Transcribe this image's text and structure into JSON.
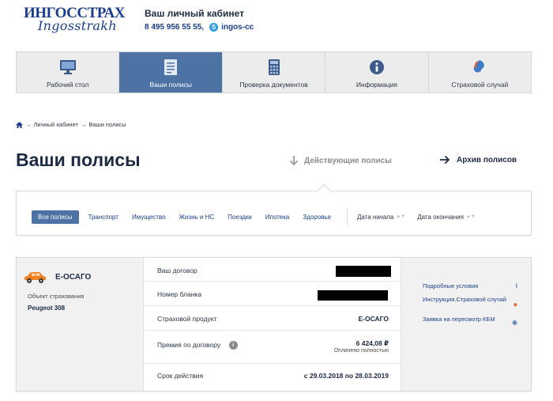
{
  "header": {
    "logo_main": "ИНГОССТРАХ",
    "logo_sub": "Ingosstrakh",
    "cabinet_title": "Ваш личный кабинет",
    "phone": "8 495 956 55 55,",
    "skype": "ingos-cc"
  },
  "nav": {
    "items": [
      {
        "label": "Рабочий стол",
        "icon": "desktop-icon"
      },
      {
        "label": "Ваши полисы",
        "icon": "document-icon"
      },
      {
        "label": "Проверка документов",
        "icon": "calculator-icon"
      },
      {
        "label": "Информация",
        "icon": "info-icon"
      },
      {
        "label": "Страховой случай",
        "icon": "swirl-icon"
      }
    ],
    "active_index": 1
  },
  "breadcrumb": {
    "items": [
      "Личный кабинет",
      "Ваши полисы"
    ],
    "separator": "→"
  },
  "page": {
    "title": "Ваши полисы",
    "tab_active": "Действующие полисы",
    "tab_archive": "Архив полисов"
  },
  "filters": {
    "chips": [
      "Все полисы",
      "Транспорт",
      "Имущество",
      "Жизнь и НС",
      "Поездки",
      "Ипотека",
      "Здоровье"
    ],
    "sort": [
      "Дата начала",
      "Дата окончания"
    ]
  },
  "policy": {
    "name": "Е-ОСАГО",
    "object_label": "Объект страхования",
    "object_value": "Peugeot 308",
    "rows": {
      "contract_label": "Ваш договор",
      "blank_label": "Номер бланка",
      "product_label": "Страховой продукт",
      "product_value": "Е-ОСАГО",
      "premium_label": "Премия по договору",
      "premium_value": "6 424,08 ₽",
      "premium_status": "Оплачено полностью",
      "period_label": "Срок действия",
      "period_value": "с 29.03.2018 по 28.03.2019"
    },
    "links": [
      {
        "label": "Подробные условия",
        "icon": "info-small-icon"
      },
      {
        "label": "Инструкция.Страховой случай",
        "icon": "swirl-small-icon"
      },
      {
        "label": "Заявка на пересмотр КБМ",
        "icon": "globe-icon"
      }
    ]
  },
  "colors": {
    "brand": "#1b3d8f",
    "nav_active": "#4d73a5",
    "car": "#f07f1e"
  }
}
